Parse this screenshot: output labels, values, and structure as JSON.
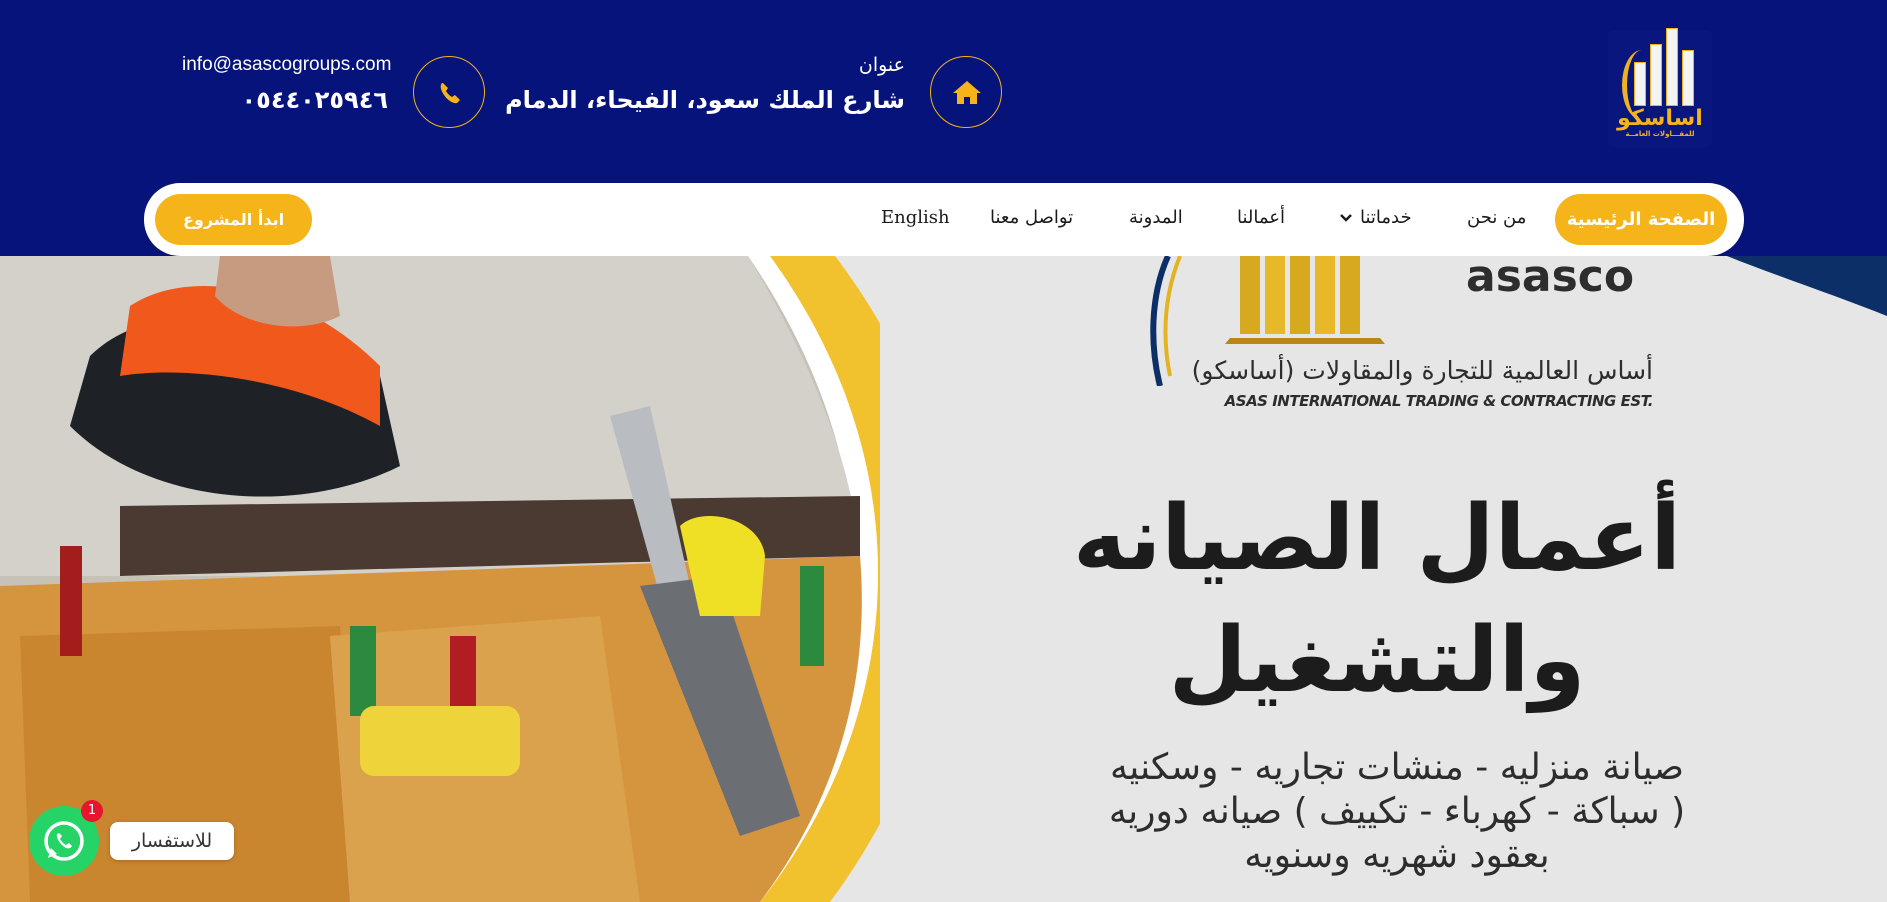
{
  "header": {
    "logo_text": "اساسكو",
    "logo_subtext": "للمقـــاولات العامــة",
    "address_label": "عنوان",
    "address_value": "شارع الملك سعود، الفيحاء، الدمام",
    "email": "info@asascogroups.com",
    "phone": "٠٥٤٤٠٢٥٩٤٦",
    "icons": [
      "home-icon",
      "phone-icon"
    ]
  },
  "nav": {
    "items": [
      {
        "label": "الصفحة الرئيسية",
        "active": true
      },
      {
        "label": "من نحن"
      },
      {
        "label": "خدماتنا",
        "has_dropdown": true
      },
      {
        "label": "أعمالنا"
      },
      {
        "label": "المدونة"
      },
      {
        "label": "تواصل معنا"
      },
      {
        "label": "English"
      }
    ],
    "cta": "ابدأ المشروع"
  },
  "hero": {
    "brand_en": "asasco",
    "brand_ar": "أساس العالمية للتجارة والمقاولات (أساسكو)",
    "brand_sub": "ASAS INTERNATIONAL TRADING & CONTRACTING EST.",
    "title_line1": "أعمال الصيانه",
    "title_line2": "والتشغيل",
    "desc_line1": "صيانة منزليه - منشات تجاريه - وسكنيه",
    "desc_line2": "( سباكة - كهرباء - تكييف ) صيانه دوريه",
    "desc_line3": "بعقود شهريه وسنويه"
  },
  "whatsapp": {
    "label": "للاستفسار",
    "badge": "1"
  },
  "colors": {
    "header_bg": "#05137a",
    "accent": "#f4b41a",
    "hero_bg": "#e6e6e6",
    "whatsapp": "#25d366"
  }
}
